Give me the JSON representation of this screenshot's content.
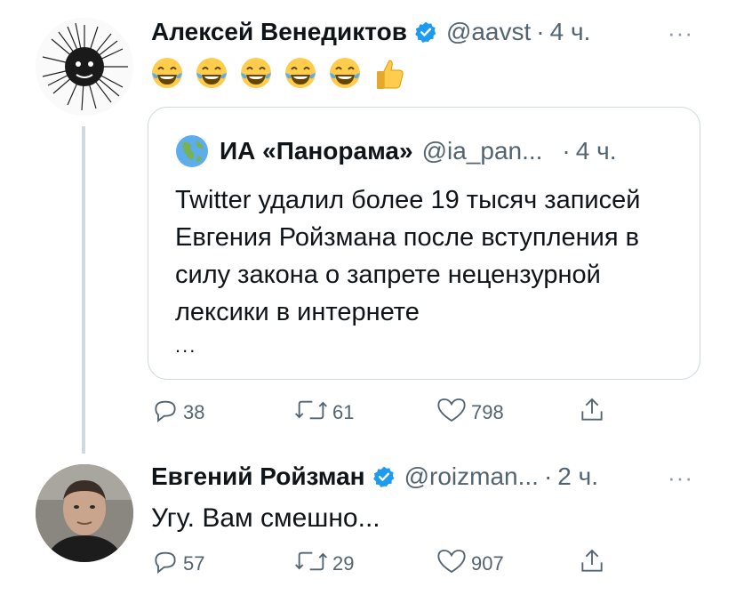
{
  "tweets": [
    {
      "author_name": "Алексей Венедиктов",
      "handle": "@aavst",
      "separator": "·",
      "time": "4 ч.",
      "more": "···",
      "emojis": [
        "joy-emoji",
        "joy-emoji",
        "joy-emoji",
        "joy-emoji",
        "joy-emoji",
        "thumbs-up-emoji"
      ],
      "quote": {
        "name": "ИА «Панорама»",
        "handle": "@ia_pan...",
        "separator": "·",
        "time": "4 ч.",
        "text": "Twitter удалил более 19 тысяч записей Евгения Ройзмана после вступления в силу закона о запрете нецензурной лексики в интернете",
        "ellipsis": "..."
      },
      "stats": {
        "replies": "38",
        "retweets": "61",
        "likes": "798"
      }
    },
    {
      "author_name": "Евгений Ройзман",
      "handle": "@roizman...",
      "separator": "·",
      "time": "2 ч.",
      "more": "···",
      "text": "Угу. Вам смешно...",
      "stats": {
        "replies": "57",
        "retweets": "29",
        "likes": "907"
      }
    }
  ],
  "colors": {
    "verified": "#1d9bf0",
    "secondary_text": "#536471",
    "border": "#cfd9de"
  }
}
